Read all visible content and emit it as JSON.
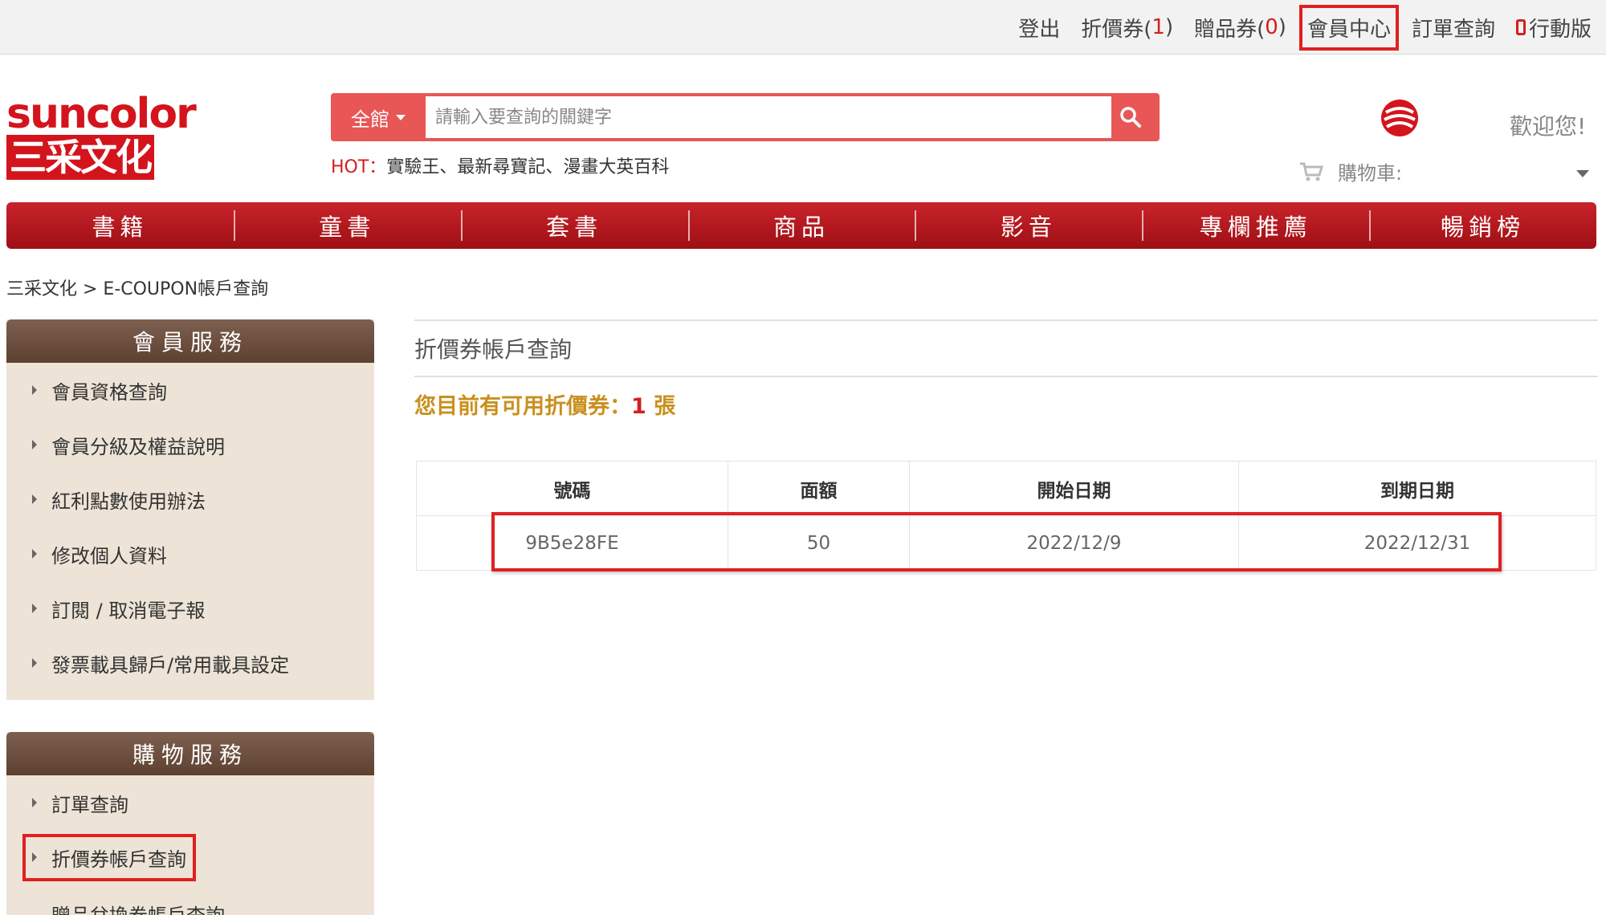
{
  "topbar": {
    "logout": "登出",
    "coupon_label": "折價券(",
    "coupon_count": "1",
    "gift_label": "贈品券(",
    "gift_count": "0",
    "close_paren": ")",
    "member_center": "會員中心",
    "order_query": "訂單查詢",
    "mobile": "行動版"
  },
  "logo": {
    "top": "suncolor",
    "bottom": "三采文化"
  },
  "search": {
    "category": "全館",
    "placeholder": "請輸入要查詢的關鍵字"
  },
  "hot": {
    "label": "HOT：",
    "items": "實驗王、最新尋寶記、漫畫大英百科"
  },
  "header": {
    "welcome": "歡迎您!",
    "cart_label": "購物車:"
  },
  "nav": [
    "書籍",
    "童書",
    "套書",
    "商品",
    "影音",
    "專欄推薦",
    "暢銷榜"
  ],
  "breadcrumb": "三采文化 > E-COUPON帳戶查詢",
  "sidebar": {
    "member": {
      "title": "會員服務",
      "items": [
        "會員資格查詢",
        "會員分級及權益說明",
        "紅利點數使用辦法",
        "修改個人資料",
        "訂閱 / 取消電子報",
        "發票載具歸戶/常用載具設定"
      ]
    },
    "shopping": {
      "title": "購物服務",
      "items": [
        "訂單查詢",
        "折價券帳戶查詢",
        "贈品兌換券帳戶查詢"
      ]
    }
  },
  "content": {
    "title": "折價券帳戶查詢",
    "avail_prefix": "您目前有可用折價券：",
    "avail_count": "1",
    "avail_suffix": " 張",
    "columns": [
      "號碼",
      "面額",
      "開始日期",
      "到期日期"
    ],
    "rows": [
      [
        "9B5e28FE",
        "50",
        "2022/12/9",
        "2022/12/31"
      ]
    ]
  },
  "colors": {
    "accent": "#d21f1f",
    "nav": "#b0161c",
    "sidebar_head": "#6b4e3e",
    "sidebar_bg": "#ede4d7",
    "notice": "#c9901e",
    "highlight": "#e02020"
  }
}
